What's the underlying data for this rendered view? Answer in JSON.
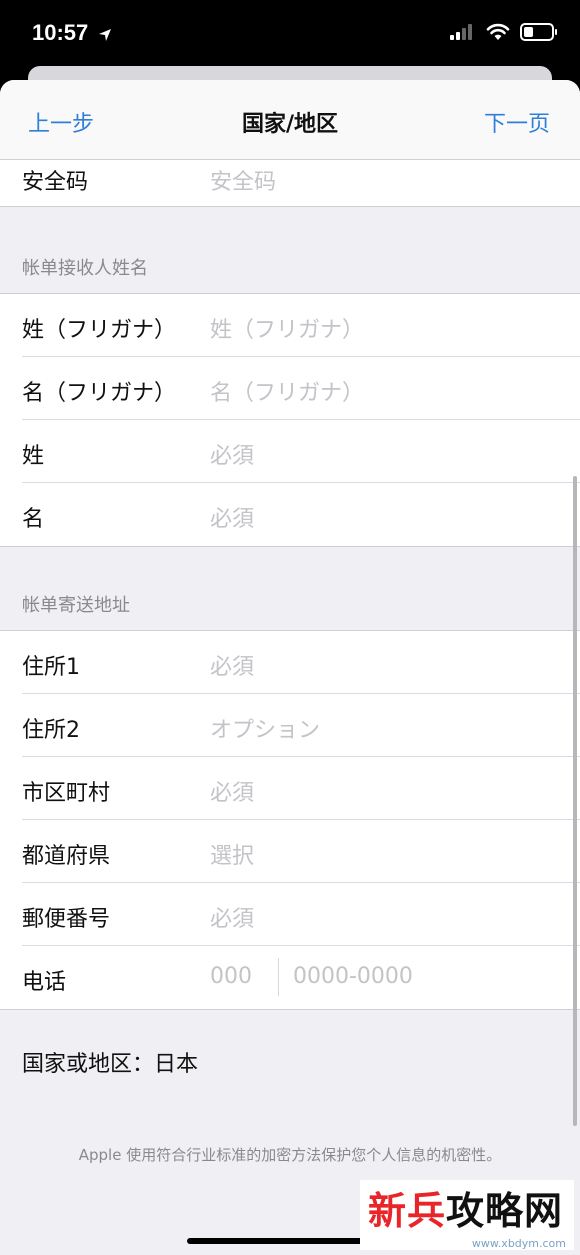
{
  "status": {
    "time": "10:57"
  },
  "nav": {
    "back": "上一步",
    "title": "国家/地区",
    "next": "下一页"
  },
  "security": {
    "label": "安全码",
    "placeholder": "安全码"
  },
  "billing_name": {
    "header": "帐单接收人姓名",
    "rows": [
      {
        "label": "姓（フリガナ）",
        "placeholder": "姓（フリガナ）"
      },
      {
        "label": "名（フリガナ）",
        "placeholder": "名（フリガナ）"
      },
      {
        "label": "姓",
        "placeholder": "必須"
      },
      {
        "label": "名",
        "placeholder": "必須"
      }
    ]
  },
  "billing_address": {
    "header": "帐单寄送地址",
    "rows": [
      {
        "label": "住所1",
        "placeholder": "必須"
      },
      {
        "label": "住所2",
        "placeholder": "オプション"
      },
      {
        "label": "市区町村",
        "placeholder": "必須"
      },
      {
        "label": "都道府県",
        "placeholder": "選択"
      },
      {
        "label": "郵便番号",
        "placeholder": "必須"
      }
    ],
    "phone": {
      "label": "电话",
      "code_placeholder": "000",
      "number_placeholder": "0000-0000"
    }
  },
  "country": {
    "text": "国家或地区：日本"
  },
  "footer": {
    "note": "Apple 使用符合行业标准的加密方法保护您个人信息的机密性。"
  },
  "watermark": {
    "brand": "新兵攻略网",
    "url": "www.xbdym.com"
  },
  "colors": {
    "accent": "#2f7ed8",
    "placeholder": "#c3c3c8",
    "section_bg": "#efeff4"
  }
}
